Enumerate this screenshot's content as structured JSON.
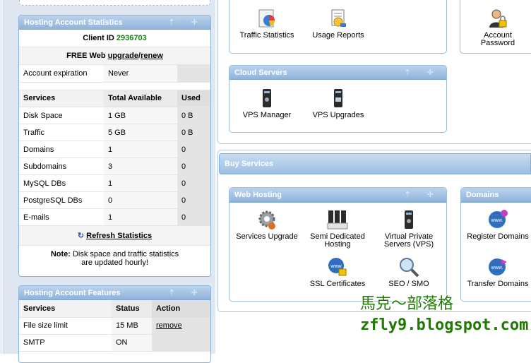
{
  "stats": {
    "title": "Hosting Account Statistics",
    "client_id_label": "Client ID",
    "client_id": "2936703",
    "free_web_label": "FREE Web",
    "upgrade": "upgrade",
    "slash": "/",
    "renew": "renew",
    "expiration_label": "Account expiration",
    "expiration_value": "Never",
    "headers": [
      "Services",
      "Total Available",
      "Used"
    ],
    "rows": [
      {
        "name": "Disk Space",
        "total": "1 GB",
        "used": "0 B"
      },
      {
        "name": "Traffic",
        "total": "5 GB",
        "used": "0 B"
      },
      {
        "name": "Domains",
        "total": "1",
        "used": "0"
      },
      {
        "name": "Subdomains",
        "total": "3",
        "used": "0"
      },
      {
        "name": "MySQL DBs",
        "total": "1",
        "used": "0"
      },
      {
        "name": "PostgreSQL DBs",
        "total": "0",
        "used": "0"
      },
      {
        "name": "E-mails",
        "total": "1",
        "used": "0"
      }
    ],
    "refresh": "Refresh Statistics",
    "note_label": "Note:",
    "note_line1": "Disk space and traffic statistics",
    "note_line2": "are updated hourly!"
  },
  "features": {
    "title": "Hosting Account Features",
    "headers": [
      "Services",
      "Status",
      "Action"
    ],
    "rows": [
      {
        "name": "File size limit",
        "status": "15 MB",
        "action": "remove"
      },
      {
        "name": "SMTP",
        "status": "ON",
        "action": ""
      }
    ]
  },
  "top_icons": {
    "traffic": "Traffic Statistics",
    "usage": "Usage Reports",
    "account_line1": "Account",
    "account_line2": "Password"
  },
  "cloud": {
    "title": "Cloud Servers",
    "vps_manager": "VPS Manager",
    "vps_upgrades": "VPS Upgrades"
  },
  "buy": {
    "title": "Buy Services"
  },
  "web_hosting": {
    "title": "Web Hosting",
    "services_upgrade": "Services Upgrade",
    "semi_line1": "Semi Dedicated",
    "semi_line2": "Hosting",
    "vps_line1": "Virtual Private",
    "vps_line2": "Servers (VPS)",
    "ssl": "SSL Certificates",
    "seo": "SEO / SMO"
  },
  "domains": {
    "title": "Domains",
    "register": "Register Domains",
    "transfer": "Transfer Domains",
    "www": "www."
  },
  "panel_controls": "⇡ ✛",
  "watermark": {
    "line1": "馬克～部落格",
    "line2": "zfly9.blogspot.com"
  },
  "colors": {
    "accent": "#8eb3db",
    "client_id": "#1a7a1a",
    "watermark": "#1e7a00"
  }
}
